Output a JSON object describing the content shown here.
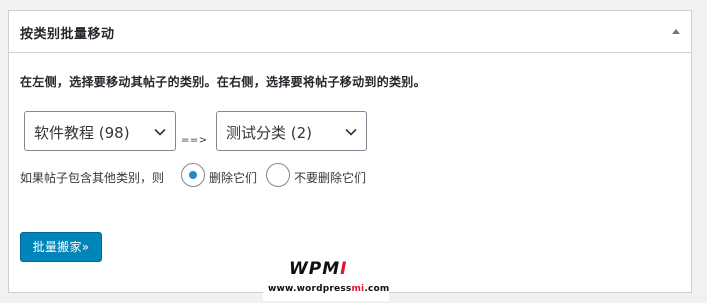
{
  "panel": {
    "title": "按类别批量移动",
    "toggle_icon": "triangle-up-icon"
  },
  "intro_text": "在左侧，选择要移动其帖子的类别。在右侧，选择要将帖子移动到的类别。",
  "source_select": {
    "value": "软件教程  (98)"
  },
  "arrow_text": "==>",
  "target_select": {
    "value": "测试分类  (2)"
  },
  "condition": {
    "label": "如果帖子包含其他类别，则",
    "options": [
      {
        "label": "删除它们",
        "selected": true
      },
      {
        "label": "不要删除它们",
        "selected": false
      }
    ]
  },
  "submit_button": {
    "label": "批量搬家»"
  },
  "watermark": {
    "logo_prefix": "WPM",
    "logo_suffix": "I",
    "url_prefix": "www.wordpress",
    "url_mid": "mi",
    "url_suffix": ".com"
  },
  "colors": {
    "primary": "#0085ba",
    "radio_dot": "#1e8cbe",
    "brand_red": "#e8112d",
    "border": "#ccd0d4"
  }
}
